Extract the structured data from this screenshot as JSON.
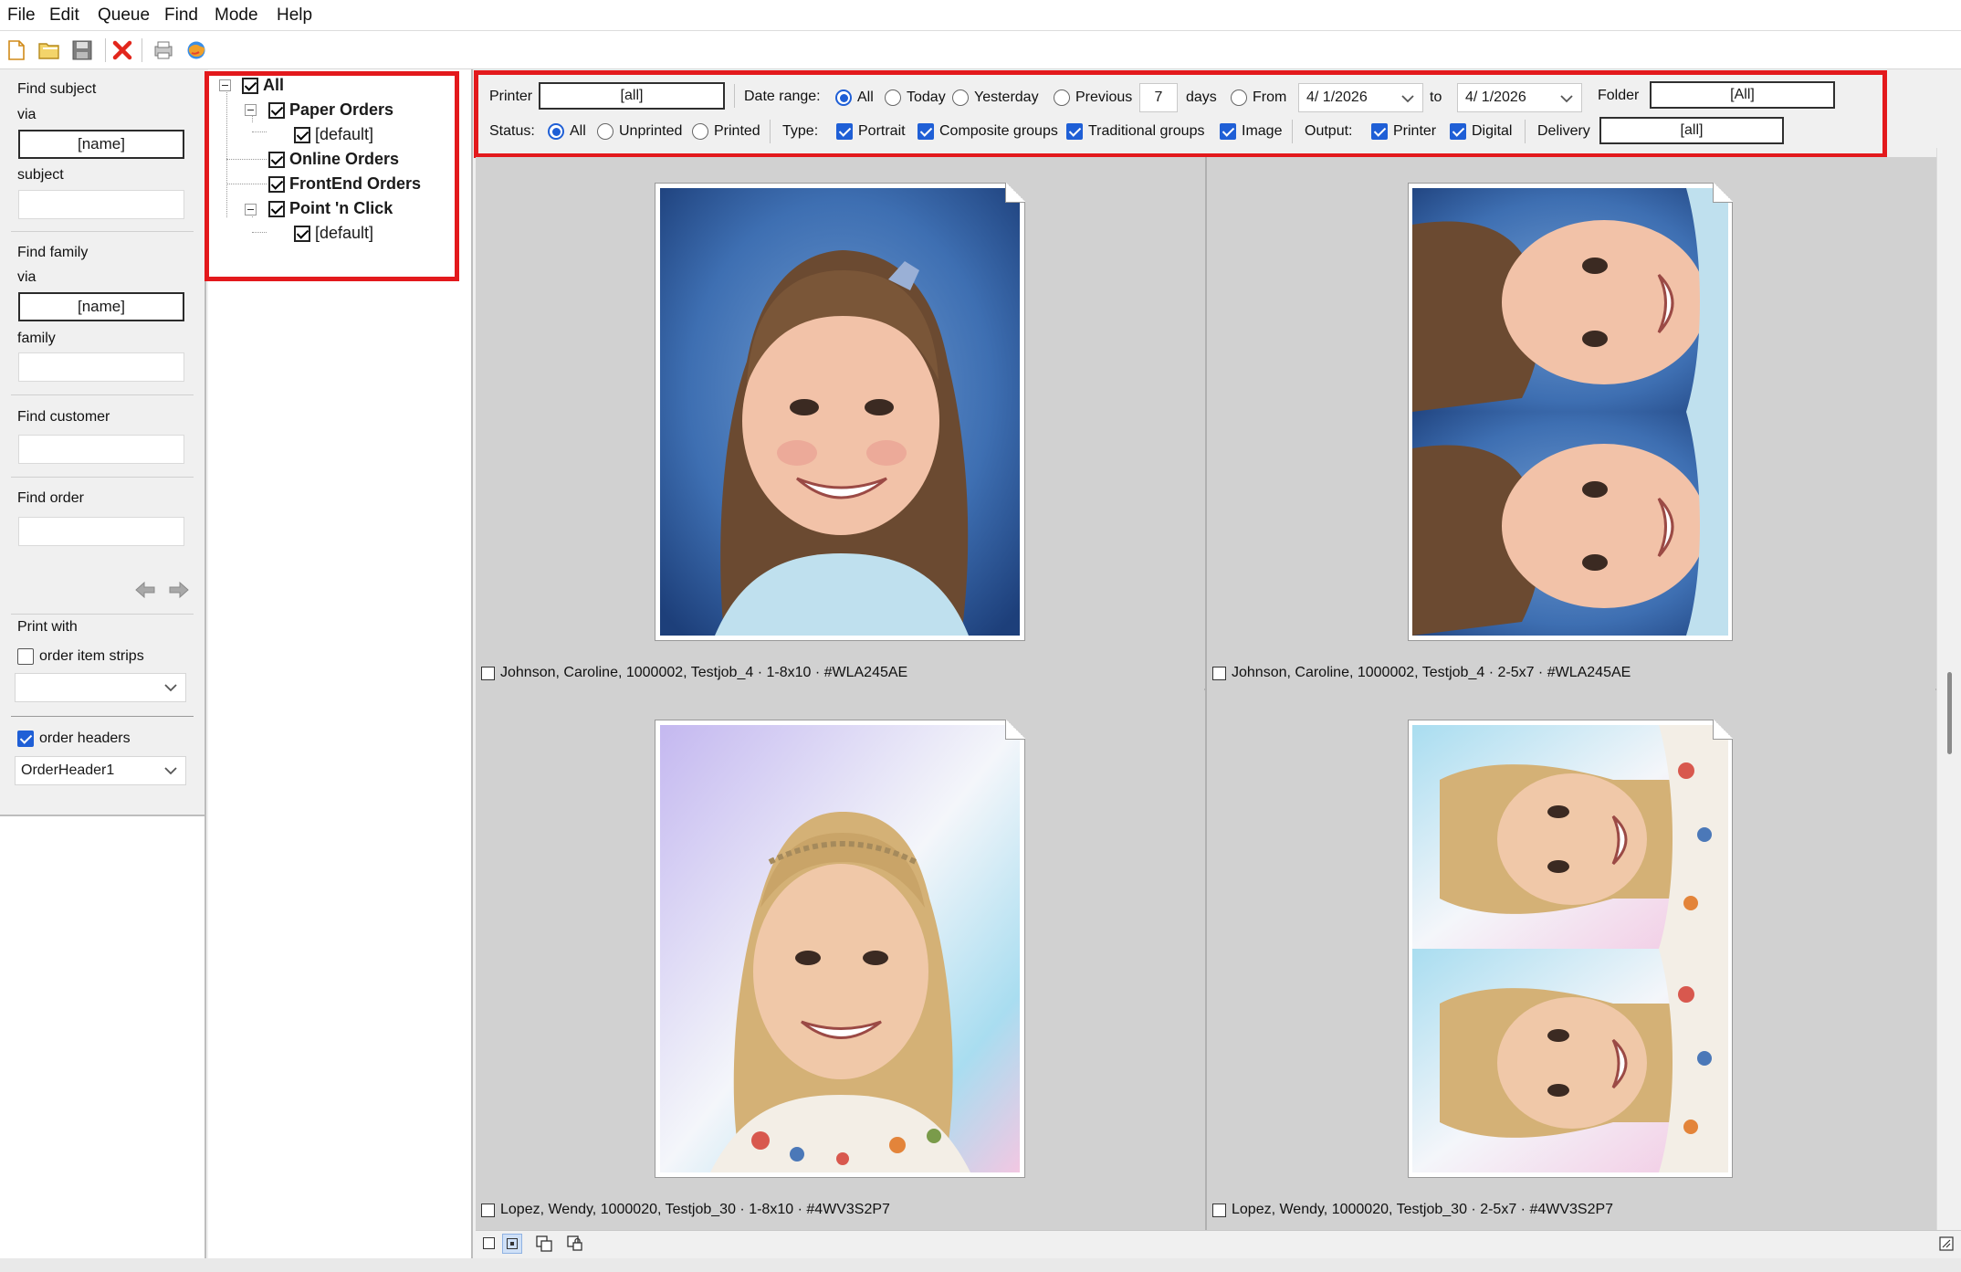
{
  "menu": [
    "File",
    "Edit",
    "Queue",
    "Find",
    "Mode",
    "Help"
  ],
  "toolbar": {
    "icons": [
      "new-document-icon",
      "open-folder-icon",
      "save-icon",
      "delete-icon",
      "print-icon",
      "globe-icon"
    ]
  },
  "left_panel": {
    "find_subject": {
      "title": "Find subject",
      "via_label": "via",
      "via_value": "[name]",
      "field_label": "subject",
      "field_value": ""
    },
    "find_family": {
      "title": "Find family",
      "via_label": "via",
      "via_value": "[name]",
      "field_label": "family",
      "field_value": ""
    },
    "find_customer": {
      "title": "Find customer",
      "value": ""
    },
    "find_order": {
      "title": "Find order",
      "value": ""
    },
    "print_with": {
      "title": "Print with",
      "order_item_strips": {
        "label": "order item strips",
        "checked": false,
        "combo_value": ""
      },
      "order_headers": {
        "label": "order headers",
        "checked": true,
        "combo_value": "OrderHeader1"
      }
    }
  },
  "tree": {
    "root": "All",
    "nodes": [
      {
        "label": "Paper Orders",
        "children": [
          "[default]"
        ]
      },
      {
        "label": "Online Orders",
        "children": []
      },
      {
        "label": "FrontEnd Orders",
        "children": []
      },
      {
        "label": "Point 'n Click",
        "children": [
          "[default]"
        ]
      }
    ]
  },
  "filter": {
    "printer_label": "Printer",
    "printer_value": "[all]",
    "date_range_label": "Date range:",
    "date_options": [
      "All",
      "Today",
      "Yesterday",
      "Previous"
    ],
    "date_selected": "All",
    "previous_days": "7",
    "days_label": "days",
    "from_label": "From",
    "from_date": "4/ 1/2026",
    "to_label": "to",
    "to_date": "4/ 1/2026",
    "folder_label": "Folder",
    "folder_value": "[All]",
    "status_label": "Status:",
    "status_options": [
      "All",
      "Unprinted",
      "Printed"
    ],
    "status_selected": "All",
    "type_label": "Type:",
    "types": [
      "Portrait",
      "Composite groups",
      "Traditional groups",
      "Image"
    ],
    "output_label": "Output:",
    "outputs": [
      "Printer",
      "Digital"
    ],
    "delivery_label": "Delivery",
    "delivery_value": "[all]"
  },
  "items": [
    {
      "caption": "Johnson, Caroline, 1000002, Testjob_4 · 1-8x10 · #WLA245AE",
      "layout": "1-8x10",
      "subject": "brunette-girl-blue-backdrop",
      "checked": false
    },
    {
      "caption": "Johnson, Caroline, 1000002, Testjob_4 · 2-5x7 · #WLA245AE",
      "layout": "2-5x7",
      "subject": "brunette-girl-blue-backdrop",
      "checked": false
    },
    {
      "caption": "Lopez, Wendy, 1000020, Testjob_30 · 1-8x10 · #4WV3S2P7",
      "layout": "1-8x10",
      "subject": "blonde-girl-pastel-backdrop",
      "checked": false
    },
    {
      "caption": "Lopez, Wendy, 1000020, Testjob_30 · 2-5x7 · #4WV3S2P7",
      "layout": "2-5x7",
      "subject": "blonde-girl-pastel-backdrop",
      "checked": false
    }
  ],
  "view_modes": [
    "single-view-icon",
    "grid-view-icon",
    "copy-view-icon",
    "lock-view-icon"
  ],
  "colors": {
    "highlight": "#e3191c",
    "accent": "#1f5fd6",
    "grid_bg": "#d1d1d1"
  }
}
